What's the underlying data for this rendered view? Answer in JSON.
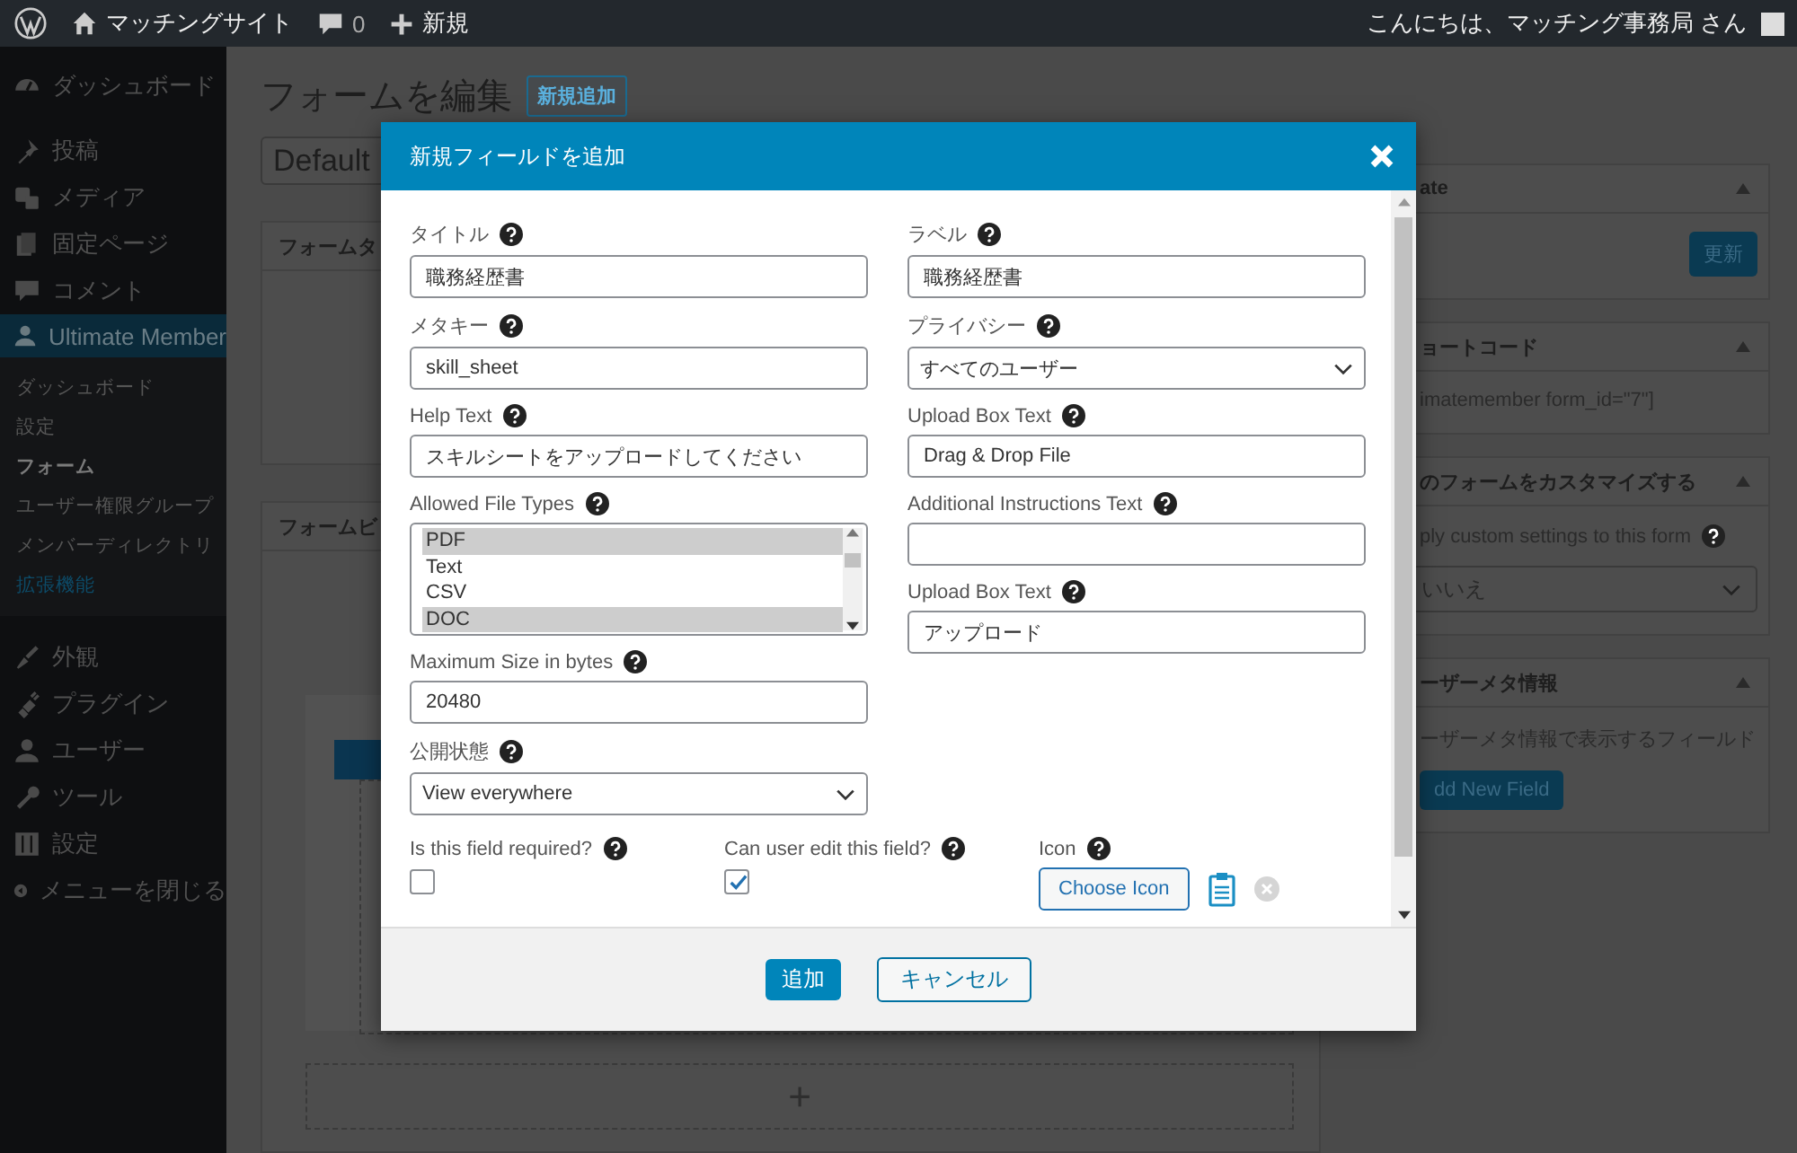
{
  "admin_bar": {
    "site_name": "マッチングサイト",
    "comments": "0",
    "new_label": "新規",
    "greeting": "こんにちは、マッチング事務局 さん"
  },
  "sidebar": {
    "sections": [
      [
        {
          "label": "ダッシュボード",
          "selected": false
        }
      ],
      [
        {
          "label": "投稿",
          "selected": false
        },
        {
          "label": "メディア",
          "selected": false
        },
        {
          "label": "固定ページ",
          "selected": false
        },
        {
          "label": "コメント",
          "selected": false
        },
        {
          "label": "Ultimate Member",
          "selected": true,
          "children": [
            {
              "label": "ダッシュボード",
              "selected": false,
              "accent": false
            },
            {
              "label": "設定",
              "selected": false,
              "accent": false
            },
            {
              "label": "フォーム",
              "selected": true,
              "accent": false
            },
            {
              "label": "ユーザー権限グループ",
              "selected": false,
              "accent": false
            },
            {
              "label": "メンバーディレクトリ",
              "selected": false,
              "accent": false
            },
            {
              "label": "拡張機能",
              "selected": false,
              "accent": true
            }
          ]
        }
      ],
      [
        {
          "label": "外観",
          "selected": false
        },
        {
          "label": "プラグイン",
          "selected": false
        },
        {
          "label": "ユーザー",
          "selected": false
        },
        {
          "label": "ツール",
          "selected": false
        },
        {
          "label": "設定",
          "selected": false
        },
        {
          "label": "メニューを閉じる",
          "selected": false
        }
      ]
    ]
  },
  "page": {
    "title": "フォームを編集",
    "add_new": "新規追加",
    "form_name": "Default",
    "left_panels": [
      {
        "title": "フォームタ"
      },
      {
        "title": "フォームビ",
        "add_row": "+"
      }
    ],
    "right_panels": [
      {
        "title": "ate",
        "button": "更新"
      },
      {
        "title": "ョートコード",
        "text": "imatemember form_id=\"7\"]"
      },
      {
        "title": "のフォームをカスタマイズする",
        "text": "ply custom settings to this form",
        "select": "いいえ"
      },
      {
        "title": "ーザーメタ情報",
        "text": "ーザーメタ情報で表示するフィールド",
        "button": "dd New Field"
      }
    ]
  },
  "modal": {
    "title": "新規フィールドを追加",
    "left_fields": [
      {
        "label": "タイトル",
        "kind": "text",
        "value": "職務経歴書"
      },
      {
        "label": "メタキー",
        "kind": "text",
        "value": "skill_sheet"
      },
      {
        "label": "Help Text",
        "kind": "text",
        "value": "スキルシートをアップロードしてください"
      },
      {
        "label": "Allowed File Types",
        "kind": "listbox",
        "options": [
          {
            "label": "PDF",
            "selected": true
          },
          {
            "label": "Text",
            "selected": false
          },
          {
            "label": "CSV",
            "selected": false
          },
          {
            "label": "DOC",
            "selected": true
          }
        ]
      },
      {
        "label": "Maximum Size in bytes",
        "kind": "text",
        "value": "20480"
      },
      {
        "label": "公開状態",
        "kind": "select",
        "value": "View everywhere"
      }
    ],
    "right_fields": [
      {
        "label": "ラベル",
        "kind": "text",
        "value": "職務経歴書"
      },
      {
        "label": "プライバシー",
        "kind": "select",
        "value": "すべてのユーザー"
      },
      {
        "label": "Upload Box Text",
        "kind": "text",
        "value": "Drag & Drop File"
      },
      {
        "label": "Additional Instructions Text",
        "kind": "text"
      },
      {
        "label": "Upload Box Text",
        "kind": "text",
        "value": "アップロード"
      }
    ],
    "checks": [
      {
        "label": "Is this field required?",
        "checked": false
      },
      {
        "label": "Can user edit this field?",
        "checked": true
      }
    ],
    "icon_field": {
      "label": "Icon",
      "button": "Choose Icon"
    },
    "buttons": [
      {
        "label": "追加",
        "kind": "primary"
      },
      {
        "label": "キャンセル",
        "kind": "secondary"
      }
    ]
  }
}
